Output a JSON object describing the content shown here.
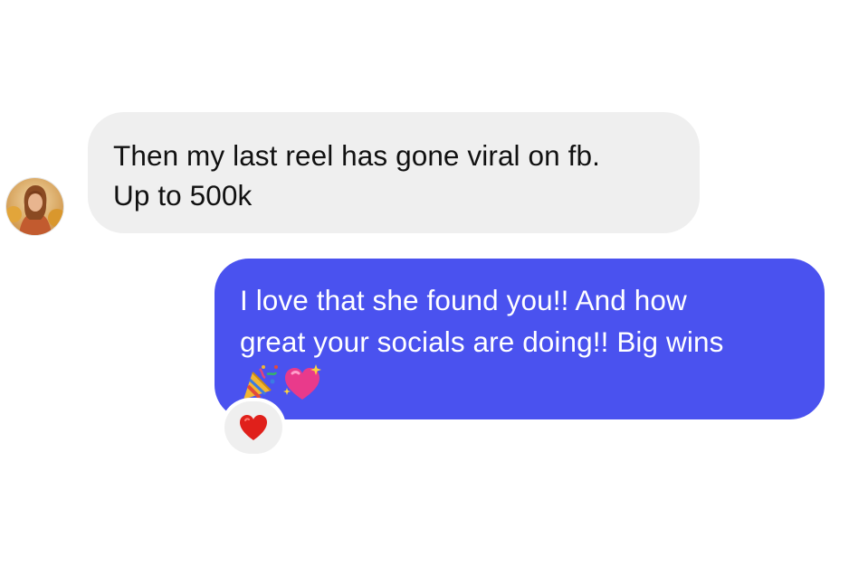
{
  "thread": {
    "incoming": {
      "sender_avatar": "profile-photo",
      "lines": [
        "Then my last reel has gone viral on fb.",
        "Up to 500k"
      ],
      "bubble_color": "#efefef"
    },
    "outgoing": {
      "lines": [
        "I love that she found you!! And how",
        "great your socials are doing!! Big wins"
      ],
      "emojis": [
        "party-popper-emoji",
        "sparkling-heart-emoji"
      ],
      "bubble_color": "#4a52ef"
    },
    "reaction": {
      "emoji": "red-heart-emoji",
      "color": "#e0201b"
    }
  }
}
